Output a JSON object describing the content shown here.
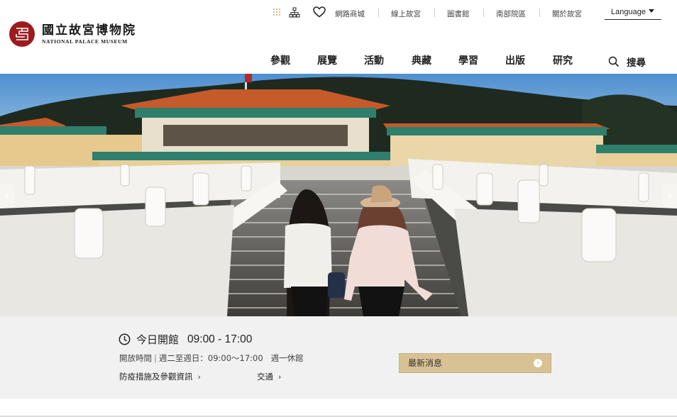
{
  "brand": {
    "name_cn": "國立故宮博物院",
    "name_en": "NATIONAL PALACE MUSEUM",
    "seal_color": "#9b1b1f"
  },
  "utility_nav": {
    "icons": [
      "dots-menu-icon",
      "sitemap-icon",
      "heart-icon"
    ],
    "links": [
      "網路商城",
      "線上故宮",
      "圖書館",
      "南部院區",
      "關於故宮"
    ],
    "language_label": "Language"
  },
  "main_nav": {
    "items": [
      "參觀",
      "展覽",
      "活動",
      "典藏",
      "學習",
      "出版",
      "研究"
    ],
    "search_label": "搜尋"
  },
  "hero": {
    "prev_label": "‹",
    "next_label": "›"
  },
  "visit_info": {
    "today_label": "今日開館",
    "today_hours": "09:00 - 17:00",
    "hours_label": "開放時間",
    "hours_text": "週二至週日：09:00～17:00",
    "closed_text": "週一休館",
    "covid_link": "防疫措施及參觀資訊",
    "transport_link": "交通",
    "news_button": "最新消息",
    "accent_color": "#d8c293"
  }
}
